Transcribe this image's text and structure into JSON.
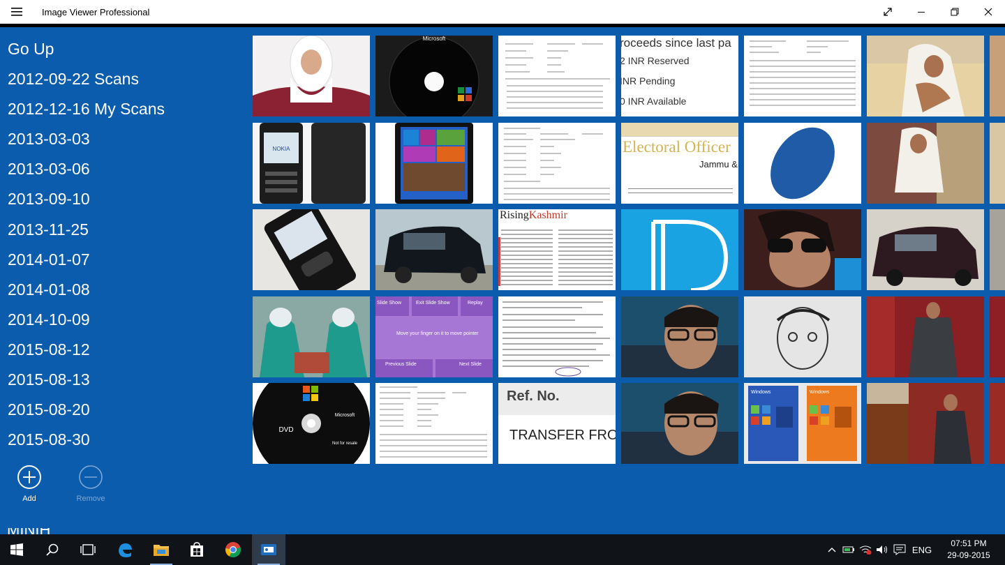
{
  "window": {
    "title": "Image Viewer Professional"
  },
  "sidebar": {
    "folders": [
      "Go Up",
      "2012-09-22 Scans",
      "2012-12-16 My Scans",
      "2013-03-03",
      "2013-03-06",
      "2013-09-10",
      "2013-11-25",
      "2014-01-07",
      "2014-01-08",
      "2014-10-09",
      "2015-08-12",
      "2015-08-13",
      "2015-08-20",
      "2015-08-30"
    ],
    "add_label": "Add",
    "remove_label": "Remove",
    "partial_text": "MINIH"
  },
  "thumbnails": {
    "scrap_text_1": [
      "roceeds since last pa",
      "2 INR Reserved",
      "INR Pending",
      "0 INR Available"
    ],
    "electoral_text": [
      "Electoral Officer",
      "Jammu &"
    ],
    "newspaper_title": [
      "Rising",
      "Kashmir"
    ],
    "slide_buttons": [
      "Slide Show",
      "Exit Slide Show",
      "Replay"
    ],
    "slide_body": "Move your finger on it to move pointer",
    "slide_footer": [
      "Previous Slide",
      "Next Slide"
    ],
    "ref_text": [
      "Ref. No.",
      "TRANSFER FRO"
    ],
    "store_text": [
      "Windows",
      "Windows"
    ],
    "cd_text": "Microsoft",
    "phone_text": "NOKIA",
    "dvd_text": [
      "Microsoft",
      "DVD",
      "Not for resale"
    ]
  },
  "taskbar": {
    "language": "ENG",
    "time": "07:51 PM",
    "date": "29-09-2015"
  }
}
